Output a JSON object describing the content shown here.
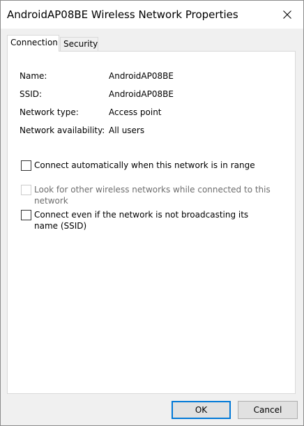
{
  "window": {
    "title": "AndroidAP08BE Wireless Network Properties"
  },
  "tabs": [
    {
      "label": "Connection",
      "active": true
    },
    {
      "label": "Security",
      "active": false
    }
  ],
  "properties": [
    {
      "label": "Name:",
      "value": "AndroidAP08BE"
    },
    {
      "label": "SSID:",
      "value": "AndroidAP08BE"
    },
    {
      "label": "Network type:",
      "value": "Access point"
    },
    {
      "label": "Network availability:",
      "value": "All users"
    }
  ],
  "options": [
    {
      "label": "Connect automatically when this network is in range",
      "checked": false,
      "enabled": true
    },
    {
      "label": "Look for other wireless networks while connected to this network",
      "checked": false,
      "enabled": false
    },
    {
      "label": "Connect even if the network is not broadcasting its name (SSID)",
      "checked": false,
      "enabled": true
    }
  ],
  "buttons": {
    "ok_label": "OK",
    "cancel_label": "Cancel"
  },
  "colors": {
    "accent": "#0078d7",
    "disabled_text": "#6d6d6d",
    "panel_background": "#ffffff",
    "dialog_background": "#f0f0f0"
  },
  "icons": {
    "close": "close-icon"
  }
}
